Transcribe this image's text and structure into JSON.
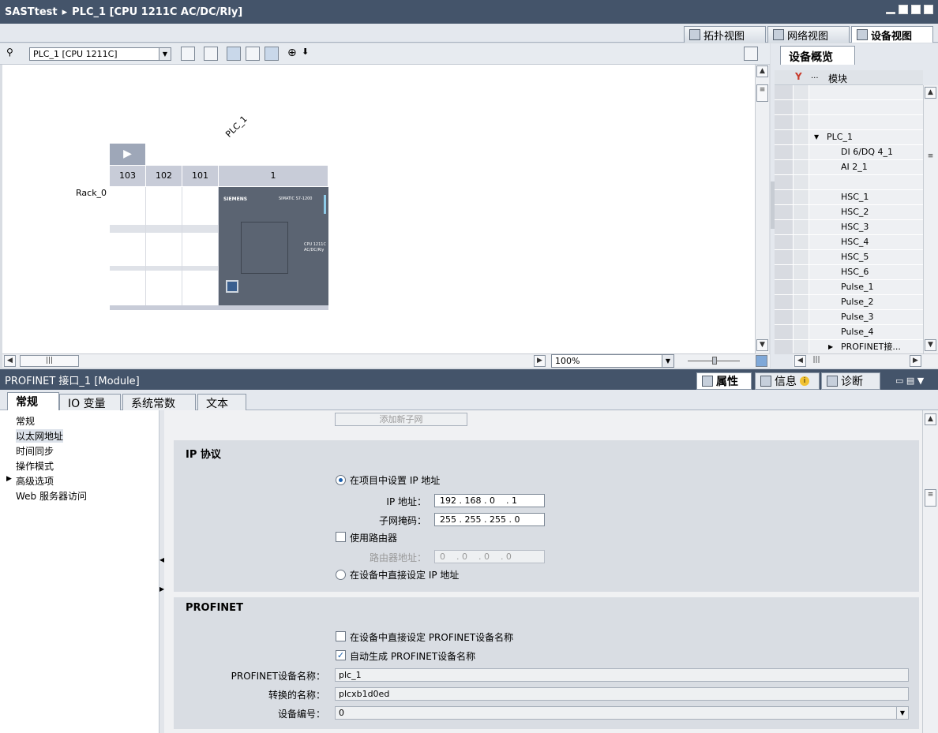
{
  "window": {
    "project": "SASTtest",
    "device": "PLC_1 [CPU 1211C AC/DC/Rly]"
  },
  "view_tabs": [
    "拓扑视图",
    "网络视图",
    "设备视图"
  ],
  "toolbar": {
    "device_select": "PLC_1 [CPU 1211C]"
  },
  "canvas": {
    "plc_label": "PLC_1",
    "rack_label": "Rack_0",
    "slots": [
      "103",
      "102",
      "101",
      "1"
    ],
    "cpu_brand": "SIEMENS",
    "cpu_model": "SIMATIC S7-1200",
    "cpu_type": "CPU 1211C",
    "cpu_variant": "AC/DC/Rly",
    "zoom": "100%"
  },
  "overview": {
    "tab": "设备概览",
    "column_dots": "...",
    "column_module": "模块",
    "rows": [
      "",
      "",
      "",
      "PLC_1",
      "DI 6/DQ 4_1",
      "AI 2_1",
      "",
      "HSC_1",
      "HSC_2",
      "HSC_3",
      "HSC_4",
      "HSC_5",
      "HSC_6",
      "Pulse_1",
      "Pulse_2",
      "Pulse_3",
      "Pulse_4",
      "PROFINET接..."
    ]
  },
  "inspector": {
    "title": "PROFINET 接口_1 [Module]",
    "tabs": [
      "属性",
      "信息",
      "诊断"
    ],
    "subtabs": [
      "常规",
      "IO 变量",
      "系统常数",
      "文本"
    ],
    "nav": [
      "常规",
      "以太网地址",
      "时间同步",
      "操作模式",
      "高级选项",
      "Web 服务器访问"
    ]
  },
  "content": {
    "add_subnet": "添加新子网",
    "ip_section": "IP 协议",
    "set_in_project": "在项目中设置 IP 地址",
    "ip_label": "IP 地址：",
    "ip_value": "192 . 168 . 0    . 1",
    "mask_label": "子网掩码：",
    "mask_value": "255 . 255 . 255 . 0",
    "use_router": "使用路由器",
    "router_label": "路由器地址：",
    "router_value": "0    . 0    . 0    . 0",
    "set_on_device": "在设备中直接设定 IP 地址",
    "pn_section": "PROFINET",
    "pn_set_on_device": "在设备中直接设定 PROFINET设备名称",
    "pn_auto": "自动生成 PROFINET设备名称",
    "pn_name_label": "PROFINET设备名称：",
    "pn_name_value": "plc_1",
    "conv_label": "转换的名称：",
    "conv_value": "plcxb1d0ed",
    "devno_label": "设备编号：",
    "devno_value": "0"
  },
  "colors": {
    "title_bar": "#44546a",
    "accent": "#1b5fae",
    "cpu_body": "#5b6472"
  }
}
